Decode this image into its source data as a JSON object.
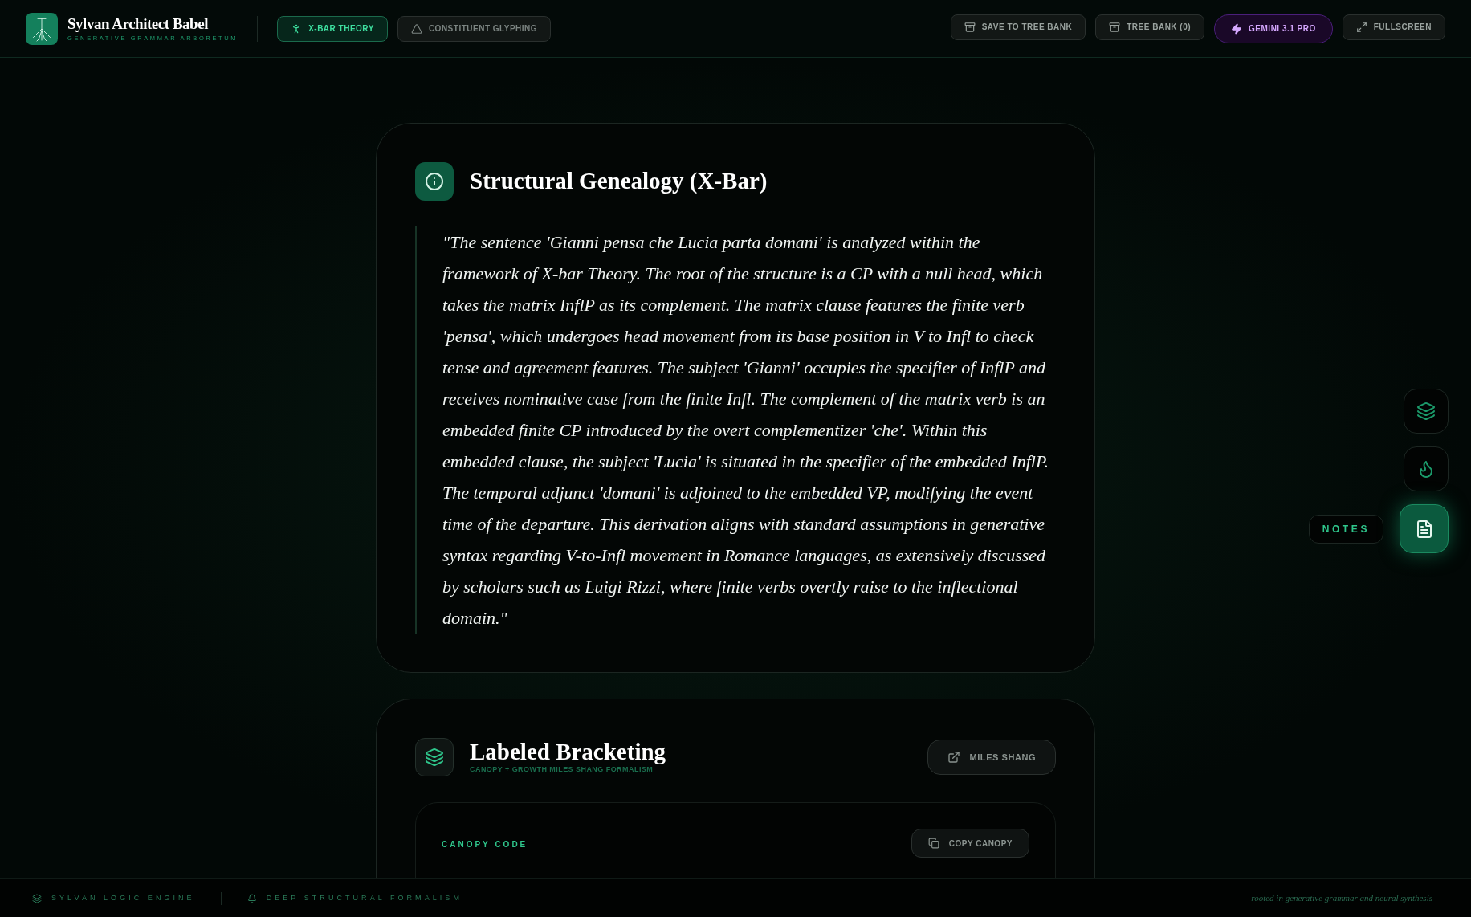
{
  "app": {
    "title": "Sylvan Architect Babel",
    "subtitle": "GENERATIVE GRAMMAR ARBORETUM"
  },
  "modes": [
    {
      "label": "X-BAR THEORY",
      "kind": "xbar",
      "selected": true
    },
    {
      "label": "CONSTITUENT GLYPHING",
      "kind": "glyph",
      "selected": false
    }
  ],
  "actions": [
    {
      "label": "SAVE TO TREE BANK",
      "kind": "save"
    },
    {
      "label": "TREE BANK (0)",
      "kind": "bank"
    },
    {
      "label": "GEMINI 3.1 PRO",
      "kind": "model"
    },
    {
      "label": "FULLSCREEN",
      "kind": "fullscreen"
    }
  ],
  "analysis": {
    "title": "Structural Genealogy (X-Bar)",
    "quote": "\"The sentence 'Gianni pensa che Lucia parta domani' is analyzed within the framework of X-bar Theory. The root of the structure is a CP with a null head, which takes the matrix InflP as its complement. The matrix clause features the finite verb 'pensa', which undergoes head movement from its base position in V to Infl to check tense and agreement features. The subject 'Gianni' occupies the specifier of InflP and receives nominative case from the finite Infl. The complement of the matrix verb is an embedded finite CP introduced by the overt complementizer 'che'. Within this embedded clause, the subject 'Lucia' is situated in the specifier of the embedded InflP. The temporal adjunct 'domani' is adjoined to the embedded VP, modifying the event time of the departure. This derivation aligns with standard assumptions in generative syntax regarding V-to-Infl movement in Romance languages, as extensively discussed by scholars such as Luigi Rizzi, where finite verbs overtly raise to the inflectional domain.\""
  },
  "bracketing": {
    "title": "Labeled Bracketing",
    "subtitle": "CANOPY + GROWTH MILES SHANG FORMALISM",
    "link": "MILES SHANG",
    "code_label": "CANOPY CODE",
    "copy": "COPY CANOPY"
  },
  "rail": [
    {
      "kind": "layers",
      "selected": false
    },
    {
      "kind": "campfire",
      "selected": false
    },
    {
      "kind": "notes",
      "label": "NOTES",
      "selected": true
    }
  ],
  "footer": {
    "left": [
      {
        "kind": "layers",
        "text": "SYLVAN LOGIC ENGINE"
      },
      {
        "kind": "bell",
        "text": "DEEP STRUCTURAL FORMALISM"
      }
    ],
    "right": "rooted in generative grammar and neural synthesis"
  }
}
